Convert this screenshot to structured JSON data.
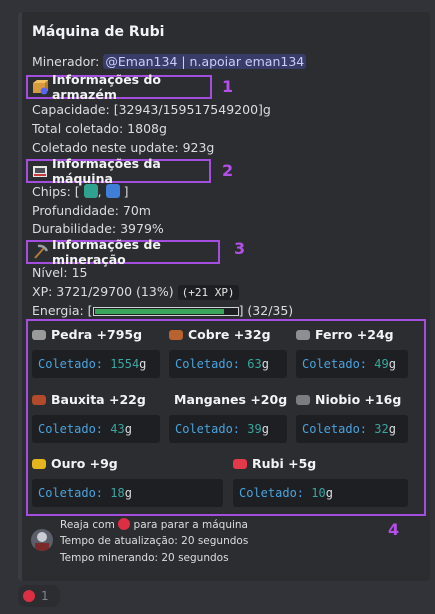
{
  "title": "Máquina de Rubi",
  "miner": {
    "label": "Minerador:",
    "mention": "@Eman134 | n.apoiar eman134"
  },
  "sections": {
    "storage": {
      "header": "Informações do armazém",
      "number": "1",
      "icon": "package-icon"
    },
    "machine": {
      "header": "Informações da máquina",
      "number": "2",
      "icon": "machine-icon"
    },
    "mining": {
      "header": "Informações de mineração",
      "number": "3",
      "icon": "pickaxe-icon"
    }
  },
  "storage": {
    "capacity": "Capacidade: [32943/159517549200]g",
    "total": "Total coletado: 1808g",
    "update": "Coletado neste update: 923g"
  },
  "machine": {
    "chips_prefix": "Chips: [",
    "chips_sep": ",",
    "chips_suffix": "]",
    "depth": "Profundidade: 70m",
    "durability": "Durabilidade: 3979%"
  },
  "mining": {
    "level": "Nível: 15",
    "xp": "XP: 3721/29700 (13%)",
    "xp_gain": "(+21 XP)",
    "energy_label": "Energia: [",
    "energy_suffix": "] (32/35)",
    "energy_fraction": 0.914
  },
  "ores_number": "4",
  "collected_label": "Coletado:",
  "ores": [
    {
      "name": "Pedra +795g",
      "collected": "1554",
      "unit": "g",
      "color": "#9a9a9a"
    },
    {
      "name": "Cobre +32g",
      "collected": "63",
      "unit": "g",
      "color": "#b8632f"
    },
    {
      "name": "Ferro +24g",
      "collected": "49",
      "unit": "g",
      "color": "#8c8f94"
    },
    {
      "name": "Bauxita +22g",
      "collected": "43",
      "unit": "g",
      "color": "#b24a2d"
    },
    {
      "name": "Manganes +20g",
      "collected": "39",
      "unit": "g",
      "color": "#6c6e72"
    },
    {
      "name": "Niobio +16g",
      "collected": "32",
      "unit": "g",
      "color": "#7a7d82"
    },
    {
      "name": "Ouro +9g",
      "collected": "18",
      "unit": "g",
      "color": "#e4b51d"
    },
    {
      "name": "Rubi +5g",
      "collected": "10",
      "unit": "g",
      "color": "#e23a4a"
    }
  ],
  "footer": {
    "react_pre": "Reaja com",
    "react_post": "para parar a máquina",
    "update_time": "Tempo de atualização: 20 segundos",
    "mining_time": "Tempo minerando: 20 segundos"
  },
  "reaction": {
    "count": "1"
  },
  "colors": {
    "accent": "#a44ee0",
    "energy": "#3ba55c",
    "stop": "#dd2e44"
  }
}
